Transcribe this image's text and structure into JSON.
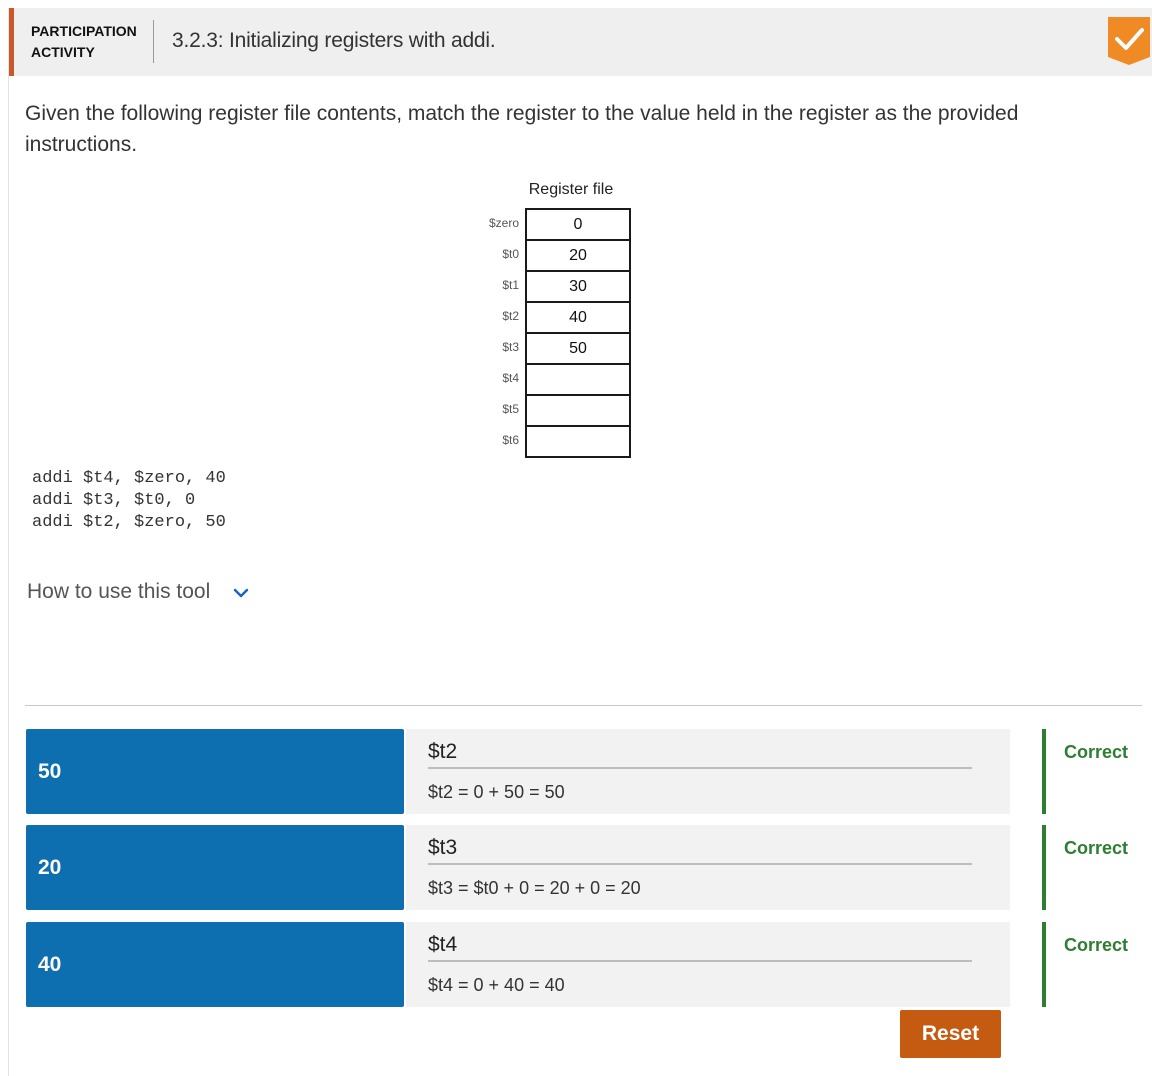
{
  "header": {
    "label_line1": "PARTICIPATION",
    "label_line2": "ACTIVITY",
    "title": "3.2.3: Initializing registers with addi.",
    "completion_icon": "check-badge-icon",
    "accent_color": "#c8592b",
    "complete_color": "#f08a24"
  },
  "instructions": "Given the following register file contents, match the register to the value held in the register as the provided instructions.",
  "register_file": {
    "title": "Register file",
    "registers": [
      {
        "name": "$zero",
        "value": "0"
      },
      {
        "name": "$t0",
        "value": "20"
      },
      {
        "name": "$t1",
        "value": "30"
      },
      {
        "name": "$t2",
        "value": "40"
      },
      {
        "name": "$t3",
        "value": "50"
      },
      {
        "name": "$t4",
        "value": ""
      },
      {
        "name": "$t5",
        "value": ""
      },
      {
        "name": "$t6",
        "value": ""
      }
    ]
  },
  "code": {
    "lines": [
      "addi $t4, $zero, 40",
      "addi $t3, $t0, 0",
      "addi $t2, $zero, 50"
    ]
  },
  "howto": {
    "label": "How to use this tool",
    "icon": "chevron-down-icon"
  },
  "matches": [
    {
      "value": "50",
      "target": "$t2",
      "explanation": "$t2 = 0 + 50 = 50",
      "status": "Correct"
    },
    {
      "value": "20",
      "target": "$t3",
      "explanation": "$t3 = $t0 + 0 = 20 + 0 = 20",
      "status": "Correct"
    },
    {
      "value": "40",
      "target": "$t4",
      "explanation": "$t4 = 0 + 40 = 40",
      "status": "Correct"
    }
  ],
  "colors": {
    "tile": "#0d6eb0",
    "correct": "#2e7d32",
    "reset": "#c55a11"
  },
  "reset_label": "Reset"
}
